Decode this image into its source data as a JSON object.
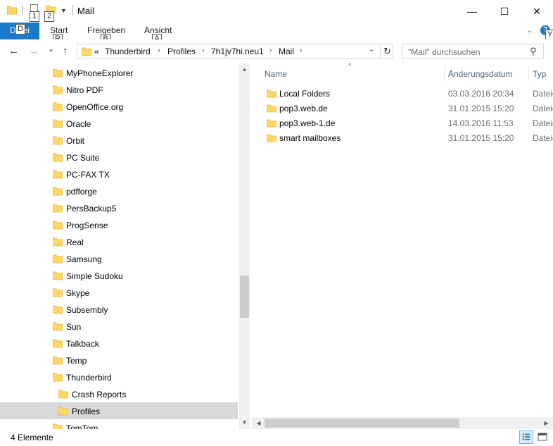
{
  "window": {
    "title": "Mail",
    "controls": {
      "minimize": "—",
      "maximize": "☐",
      "close": "✕"
    }
  },
  "quick_access": {
    "keytips": [
      "1",
      "2"
    ]
  },
  "ribbon": {
    "file_label": "Datei",
    "file_keytip": "D",
    "tabs": [
      {
        "label": "Start",
        "keytip": "R"
      },
      {
        "label": "Freigeben",
        "keytip": "B"
      },
      {
        "label": "Ansicht",
        "keytip": "A"
      }
    ],
    "help_glyph": "?",
    "help_keytip": "Y"
  },
  "nav": {
    "back": "←",
    "forward": "→",
    "recent": "⌄",
    "up": "↑",
    "breadcrumb_overflow": "«",
    "breadcrumbs": [
      "Thunderbird",
      "Profiles",
      "7h1jv7hi.neu1",
      "Mail"
    ],
    "search_placeholder": "\"Mail\" durchsuchen"
  },
  "tree": {
    "items": [
      {
        "label": "MyPhoneExplorer",
        "level": 0,
        "selected": false
      },
      {
        "label": "Nitro PDF",
        "level": 0,
        "selected": false
      },
      {
        "label": "OpenOffice.org",
        "level": 0,
        "selected": false
      },
      {
        "label": "Oracle",
        "level": 0,
        "selected": false
      },
      {
        "label": "Orbit",
        "level": 0,
        "selected": false
      },
      {
        "label": "PC Suite",
        "level": 0,
        "selected": false
      },
      {
        "label": "PC-FAX TX",
        "level": 0,
        "selected": false
      },
      {
        "label": "pdfforge",
        "level": 0,
        "selected": false
      },
      {
        "label": "PersBackup5",
        "level": 0,
        "selected": false
      },
      {
        "label": "ProgSense",
        "level": 0,
        "selected": false
      },
      {
        "label": "Real",
        "level": 0,
        "selected": false
      },
      {
        "label": "Samsung",
        "level": 0,
        "selected": false
      },
      {
        "label": "Simple Sudoku",
        "level": 0,
        "selected": false
      },
      {
        "label": "Skype",
        "level": 0,
        "selected": false
      },
      {
        "label": "Subsembly",
        "level": 0,
        "selected": false
      },
      {
        "label": "Sun",
        "level": 0,
        "selected": false
      },
      {
        "label": "Talkback",
        "level": 0,
        "selected": false
      },
      {
        "label": "Temp",
        "level": 0,
        "selected": false
      },
      {
        "label": "Thunderbird",
        "level": 0,
        "selected": false
      },
      {
        "label": "Crash Reports",
        "level": 1,
        "selected": false
      },
      {
        "label": "Profiles",
        "level": 1,
        "selected": true
      },
      {
        "label": "TomTom",
        "level": 0,
        "selected": false
      }
    ]
  },
  "columns": {
    "name": "Name",
    "date": "Änderungsdatum",
    "type": "Typ"
  },
  "files": [
    {
      "name": "Local Folders",
      "date": "03.03.2016 20:34",
      "type": "Dateio"
    },
    {
      "name": "pop3.web.de",
      "date": "31.01.2015 15:20",
      "type": "Dateio"
    },
    {
      "name": "pop3.web-1.de",
      "date": "14.03.2016 11:53",
      "type": "Dateio"
    },
    {
      "name": "smart mailboxes",
      "date": "31.01.2015 15:20",
      "type": "Dateio"
    }
  ],
  "status": {
    "count_text": "4 Elemente"
  },
  "colors": {
    "accent": "#1979ca",
    "folder_fill": "#ffd766",
    "folder_tab": "#e8b43a",
    "selection": "#d9d9d9"
  },
  "icons": {
    "folder": "folder-icon",
    "search": "search-icon",
    "refresh": "refresh-icon",
    "help": "help-icon"
  }
}
